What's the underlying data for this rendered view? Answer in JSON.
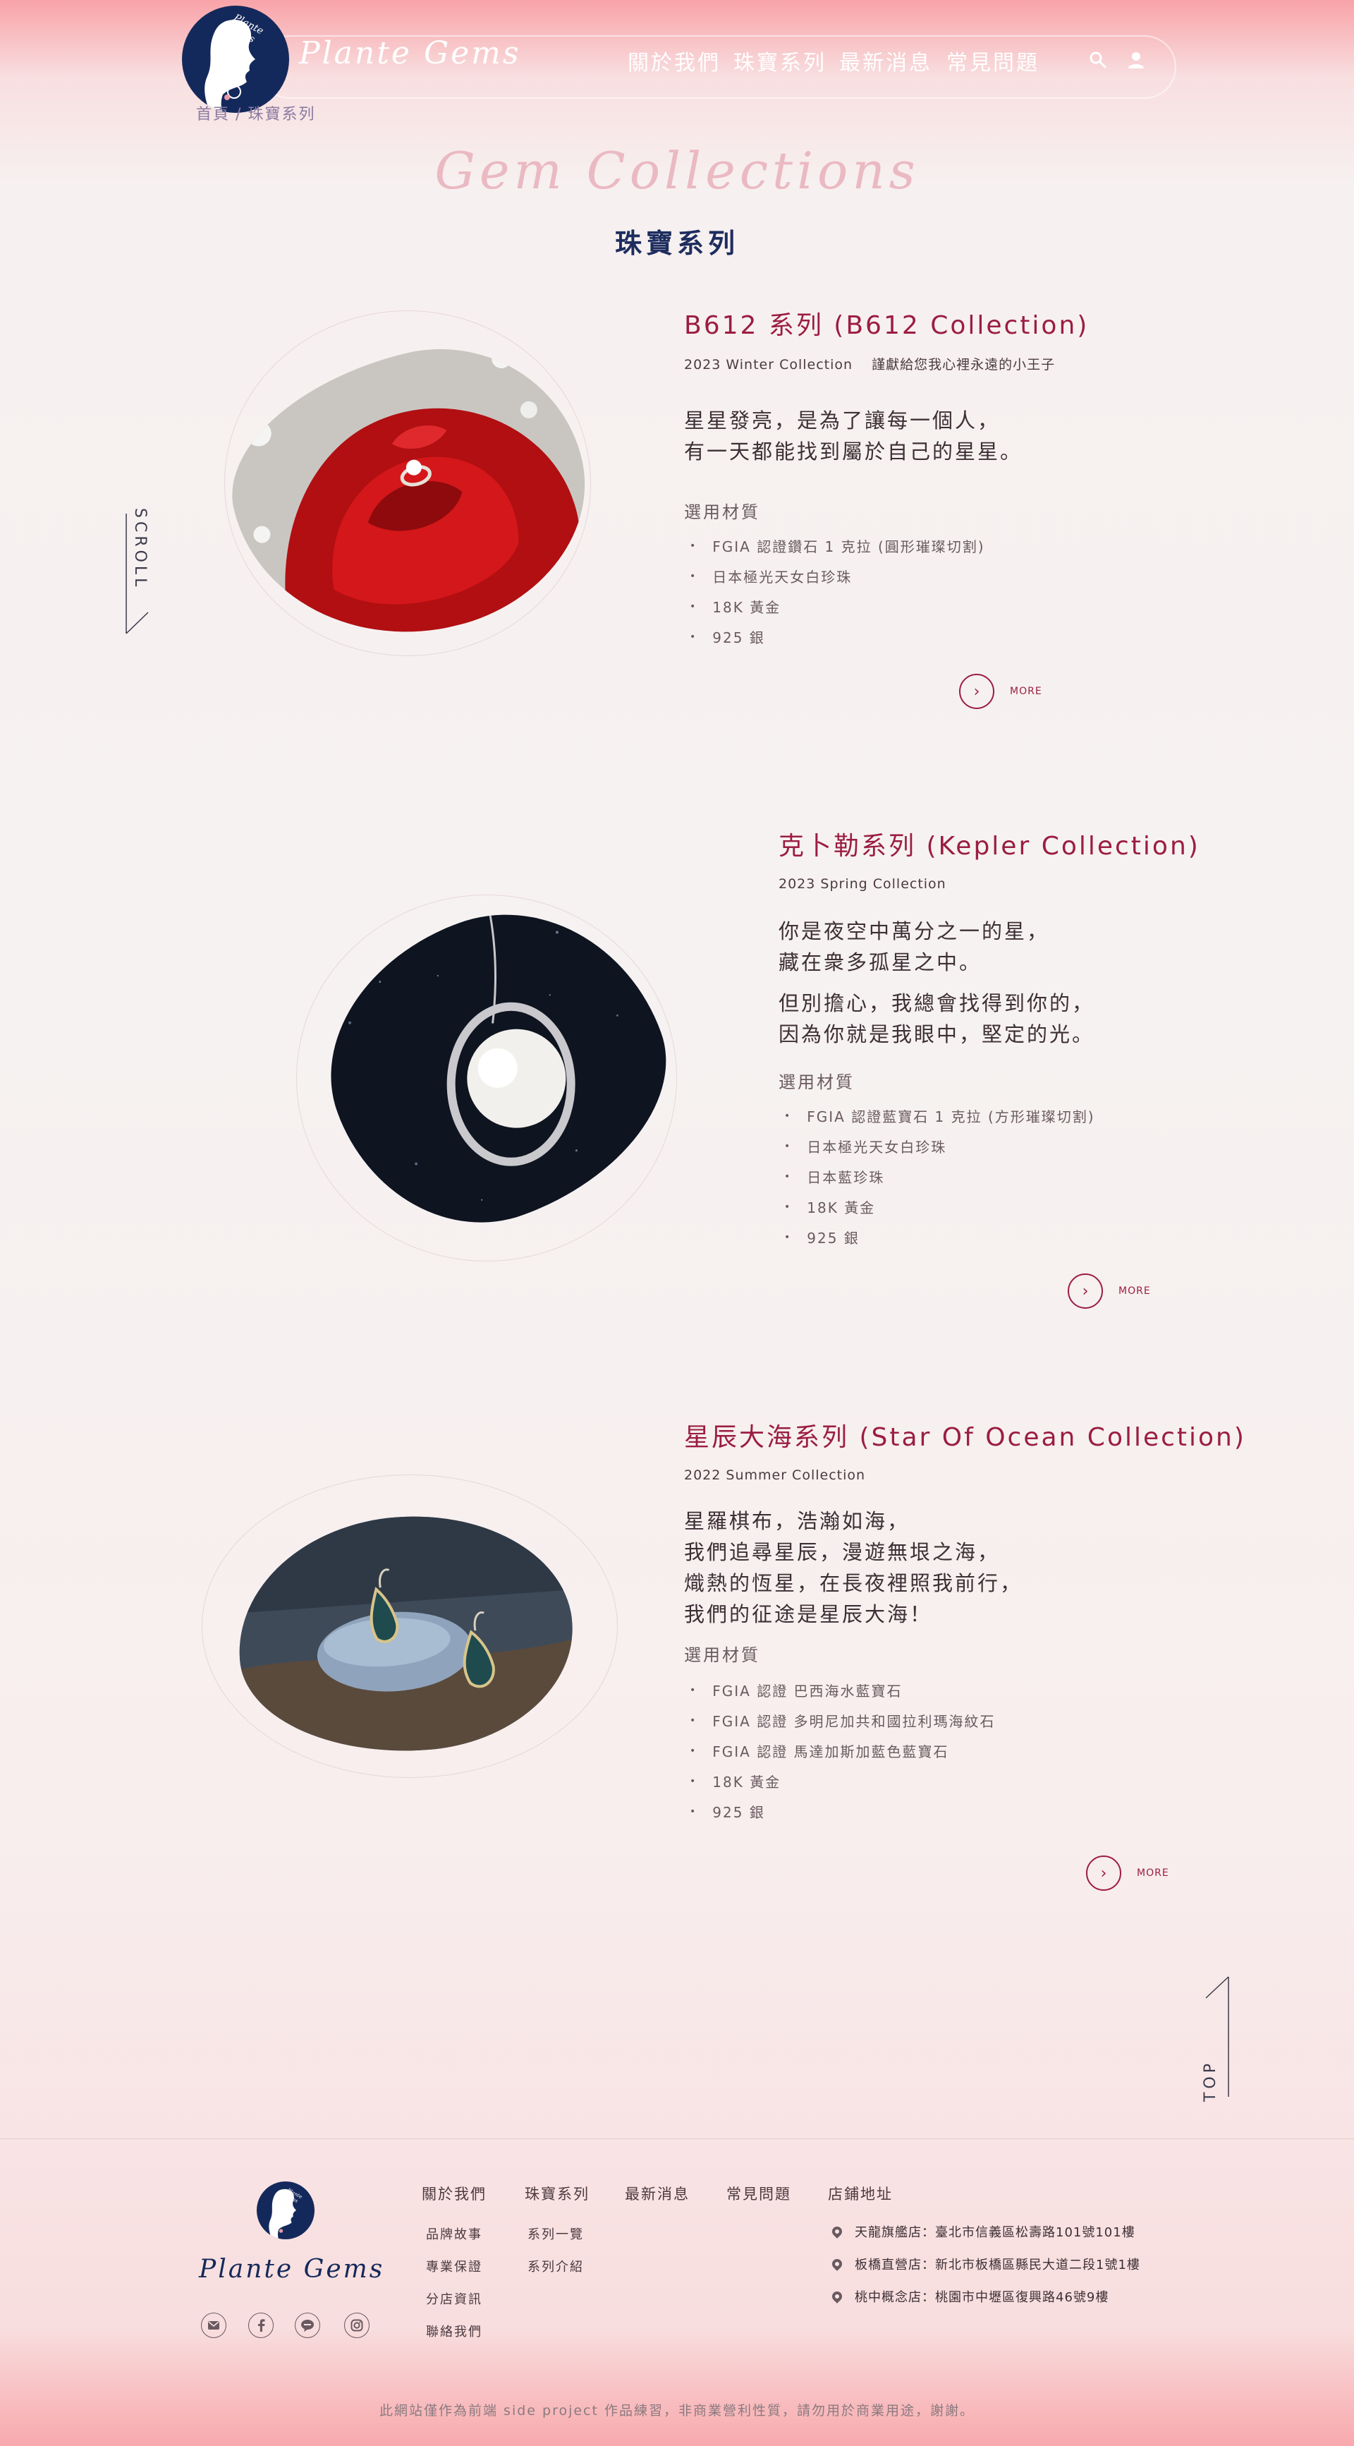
{
  "header": {
    "brand": "Plante Gems",
    "logo_script": "Plante Gems",
    "nav": [
      "關於我們",
      "珠寶系列",
      "最新消息",
      "常見問題"
    ],
    "search_icon": "search-icon",
    "user_icon": "user-icon"
  },
  "breadcrumb": {
    "home": "首頁",
    "separator": "/",
    "current": "珠寶系列"
  },
  "page": {
    "title_en": "Gem Collections",
    "title_zh": "珠寶系列"
  },
  "scroll_label": "SCROLL",
  "top_label": "TOP",
  "collections": [
    {
      "title": "B612 系列 (B612 Collection)",
      "subtitle": "2023 Winter Collection　 謹獻給您我心裡永遠的小王子",
      "description": [
        "星星發亮，是為了讓每一個人，",
        "有一天都能找到屬於自己的星星。"
      ],
      "materials_heading": "選用材質",
      "materials": [
        "FGIA 認證鑽石 1 克拉 (圓形璀璨切割)",
        "日本極光天女白珍珠",
        "18K 黃金",
        "925 銀"
      ],
      "more_label": "MORE"
    },
    {
      "title": "克卜勒系列 (Kepler Collection)",
      "subtitle": "2023 Spring Collection",
      "description": [
        "你是夜空中萬分之一的星，",
        "藏在衆多孤星之中。",
        "但別擔心，我總會找得到你的，",
        "因為你就是我眼中，堅定的光。"
      ],
      "materials_heading": "選用材質",
      "materials": [
        "FGIA 認證藍寶石 1 克拉 (方形璀璨切割)",
        "日本極光天女白珍珠",
        "日本藍珍珠",
        "18K 黃金",
        "925 銀"
      ],
      "more_label": "MORE"
    },
    {
      "title": "星辰大海系列 (Star Of Ocean Collection)",
      "subtitle": "2022 Summer Collection",
      "description": [
        "星羅棋布，浩瀚如海，",
        "我們追尋星辰，漫遊無垠之海，",
        "熾熱的恆星，在長夜裡照我前行，",
        "我們的征途是星辰大海！"
      ],
      "materials_heading": "選用材質",
      "materials": [
        "FGIA 認證 巴西海水藍寶石",
        "FGIA 認證 多明尼加共和國拉利瑪海紋石",
        "FGIA 認證 馬達加斯加藍色藍寶石",
        "18K 黃金",
        "925 銀"
      ],
      "more_label": "MORE"
    }
  ],
  "footer": {
    "brand": "Plante Gems",
    "logo_script": "Plante Gems",
    "social_icons": [
      "mail-icon",
      "facebook-icon",
      "line-icon",
      "instagram-icon"
    ],
    "columns": [
      {
        "heading": "關於我們",
        "links": [
          "品牌故事",
          "專業保證",
          "分店資訊",
          "聯絡我們"
        ]
      },
      {
        "heading": "珠寶系列",
        "links": [
          "系列一覽",
          "系列介紹"
        ]
      },
      {
        "heading": "最新消息",
        "links": []
      },
      {
        "heading": "常見問題",
        "links": []
      },
      {
        "heading": "店鋪地址",
        "links": []
      }
    ],
    "addresses": [
      "天龍旗艦店：臺北市信義區松壽路101號101樓",
      "板橋直營店：新北市板橋區縣民大道二段1號1樓",
      "桃中概念店：桃園市中壢區復興路46號9樓"
    ],
    "copyright": "此網站僅作為前端 side project 作品練習，非商業營利性質，請勿用於商業用途，謝謝。"
  },
  "colors": {
    "accent": "#9b1d43",
    "navy": "#14295b",
    "title_pink": "#eab9c2",
    "header_pink": "#f8a3a8"
  }
}
